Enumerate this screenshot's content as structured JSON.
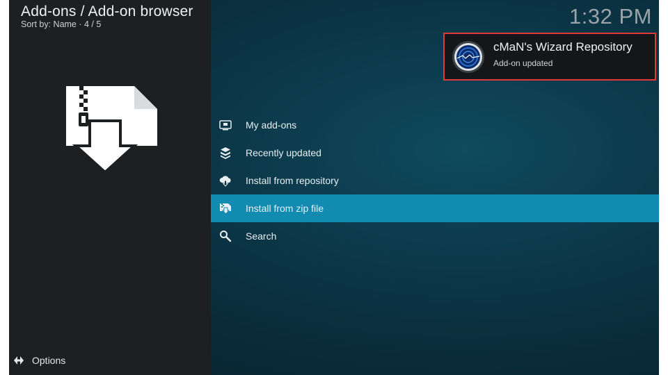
{
  "header": {
    "title": "Add-ons / Add-on browser",
    "sort_info": "Sort by: Name  ·  4 / 5"
  },
  "clock": "1:32 PM",
  "notification": {
    "title": "cMaN's Wizard Repository",
    "subtitle": "Add-on updated",
    "icon": "cman-logo-icon",
    "border_color": "#e03a3a"
  },
  "menu": {
    "items": [
      {
        "label": "My add-ons",
        "icon": "monitor-box-icon"
      },
      {
        "label": "Recently updated",
        "icon": "box-stack-icon"
      },
      {
        "label": "Install from repository",
        "icon": "cloud-download-icon"
      },
      {
        "label": "Install from zip file",
        "icon": "zip-install-icon",
        "selected": true
      },
      {
        "label": "Search",
        "icon": "search-icon"
      }
    ],
    "selected_color": "#118bb0"
  },
  "footer": {
    "options_label": "Options",
    "options_icon": "options-arrows-icon"
  }
}
